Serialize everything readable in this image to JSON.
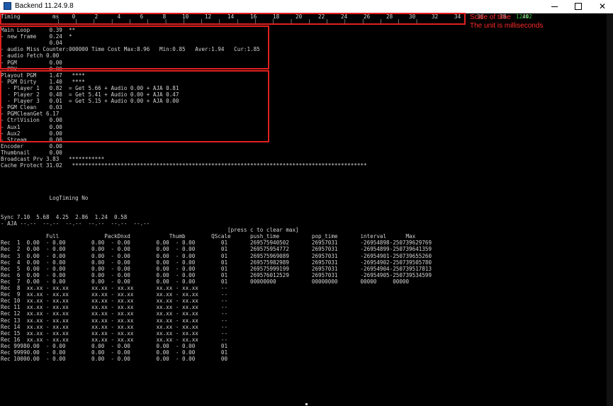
{
  "window": {
    "title": "Backend 11.24.9.8"
  },
  "console": {
    "header": "Timing          ms    0      2      4      6      8     10     12     14     16     18     20     22     24     26     28     30     32     34     36     38     40",
    "ruler": "                      |      |      |      |      |      |      |      |      |      |      |      |      |      |      |      |      |      |      |      |      |",
    "lines": [
      "Main Loop      0.39  **",
      "- new frame    0.24  *",
      "               0.04",
      "- audio Miss Counter:000000 Time Cost Max:8.96   Min:0.85   Aver:1.94   Cur:1.85",
      "- audio Fetch 0.00",
      "- PGM          0.00",
      "- PRV          0.00",
      "Playout PGM    1.47   ****",
      "- PGM Dirty    1.40   ****",
      "  - Player 1   0.82  = Get 5.66 + Audio 0.00 + AJA 0.81",
      "  - Player 2   0.48  = Get 5.41 + Audio 0.00 + AJA 0.47",
      "  - Player 3   0.01  = Get 5.15 + Audio 0.00 + AJA 0.00",
      "- PGM Clean    0.03",
      "- PGMCleanGet 6.17",
      "- CtrlVision   0.00",
      "- Aux1         0.00",
      "- Aux2         0.00",
      "- Stream       0.00",
      "Encoder        0.00",
      "Thumbnail      0.00",
      "Broadcast Prv 3.83   ***********",
      "Cache Protect 31.02   *******************************************************************************************",
      "",
      "",
      "",
      "",
      "               LogTiming No",
      "",
      "",
      "Sync 7.10  5.68  4.25  2.86  1.24  0.58",
      "- AJA --.--  --.--  --.--  --.--  --.--  --.--",
      "                                                                      [press c to clear max]",
      "              Full              PackDnxd            Thumb        QScale      push_time          pop_time       interval      Max",
      "Rec  1  0.00  - 0.00        0.00  - 0.00        0.00  - 0.00        01       269575940502       26957031       -26954898-250739629769",
      "Rec  2  0.00  - 0.00        0.00  - 0.00        0.00  - 0.00        01       269575954772       26957031       -26954899-250739641359",
      "Rec  3  0.00  - 0.00        0.00  - 0.00        0.00  - 0.00        01       269575969089       26957031       -26954901-250739655260",
      "Rec  4  0.00  - 0.00        0.00  - 0.00        0.00  - 0.00        01       269575982989       26957031       -26954902-250739505780",
      "Rec  5  0.00  - 0.00        0.00  - 0.00        0.00  - 0.00        01       269575999199       26957031       -26954904-250739517813",
      "Rec  6  0.00  - 0.00        0.00  - 0.00        0.00  - 0.00        01       269576012529       26957031       -26954905-250739534599",
      "Rec  7  0.00  - 0.00        0.00  - 0.00        0.00  - 0.00        01       00000000           00000000       00000     00000",
      "Rec  8  xx.xx - xx.xx       xx.xx - xx.xx       xx.xx - xx.xx       --",
      "Rec  9  xx.xx - xx.xx       xx.xx - xx.xx       xx.xx - xx.xx       --",
      "Rec 10  xx.xx - xx.xx       xx.xx - xx.xx       xx.xx - xx.xx       --",
      "Rec 11  xx.xx - xx.xx       xx.xx - xx.xx       xx.xx - xx.xx       --",
      "Rec 12  xx.xx - xx.xx       xx.xx - xx.xx       xx.xx - xx.xx       --",
      "Rec 13  xx.xx - xx.xx       xx.xx - xx.xx       xx.xx - xx.xx       --",
      "Rec 14  xx.xx - xx.xx       xx.xx - xx.xx       xx.xx - xx.xx       --",
      "Rec 15  xx.xx - xx.xx       xx.xx - xx.xx       xx.xx - xx.xx       --",
      "Rec 16  xx.xx - xx.xx       xx.xx - xx.xx       xx.xx - xx.xx       --",
      "Rec 99980.00  - 0.00        0.00  - 0.00        0.00  - 0.00        01",
      "Rec 99990.00  - 0.00        0.00  - 0.00        0.00  - 0.00        01",
      "Rec 10000.00  - 0.00        0.00  - 0.00        0.00  - 0.00        00"
    ]
  },
  "annotations": {
    "scale_line1": "Scale of time",
    "counter": "12/42",
    "scale_line2": "The unit is milliseconds"
  },
  "colors": {
    "annotation": "#ff2a2a",
    "counter": "#3cd23c",
    "highlight_box": "#e02020",
    "text": "#d4d4d4"
  }
}
